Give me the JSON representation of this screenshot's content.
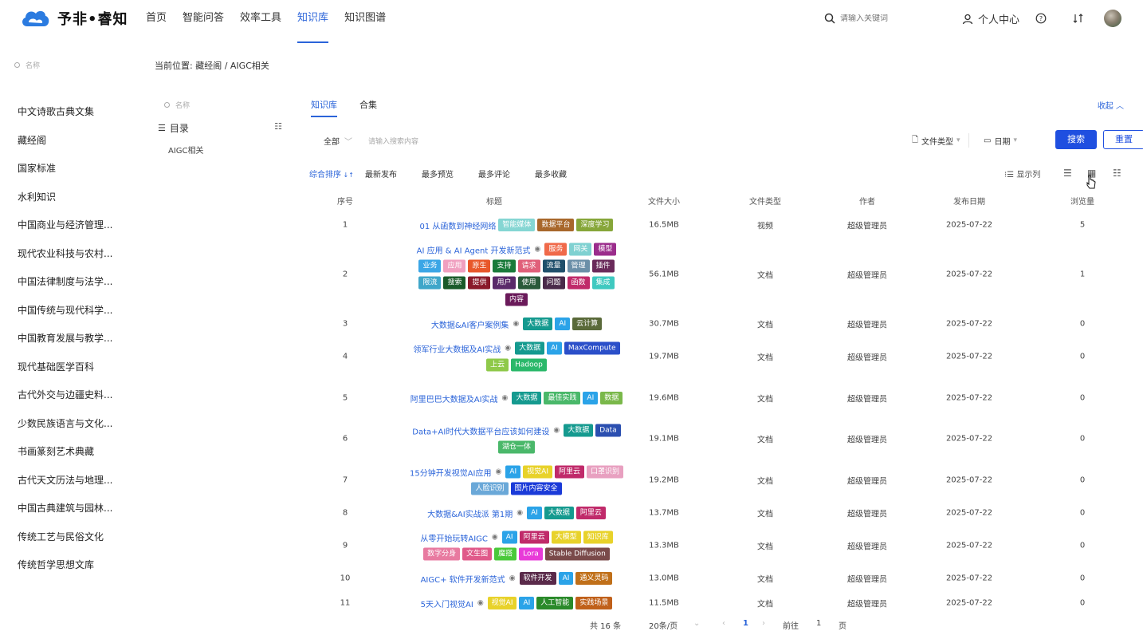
{
  "brand": {
    "name": "予非•睿知"
  },
  "nav": [
    {
      "label": "首页",
      "active": false
    },
    {
      "label": "智能问答",
      "active": false
    },
    {
      "label": "效率工具",
      "active": false
    },
    {
      "label": "知识库",
      "active": true
    },
    {
      "label": "知识图谱",
      "active": false
    }
  ],
  "top_search": {
    "placeholder": "请输入关键词"
  },
  "user_center": {
    "label": "个人中心"
  },
  "sidebar": {
    "search_placeholder": "名称",
    "items": [
      "中文诗歌古典文集",
      "藏经阁",
      "国家标准",
      "水利知识",
      "中国商业与经济管理...",
      "现代农业科技与农村...",
      "中国法律制度与法学...",
      "中国传统与现代科学...",
      "中国教育发展与教学...",
      "现代基础医学百科",
      "古代外交与边疆史料...",
      "少数民族语言与文化...",
      "书画篆刻艺术典藏",
      "古代天文历法与地理...",
      "中国古典建筑与园林...",
      "传统工艺与民俗文化",
      "传统哲学思想文库"
    ]
  },
  "breadcrumb": {
    "text": "当前位置: 藏经阁 / AIGC相关"
  },
  "directory": {
    "search_placeholder": "名称",
    "title": "目录",
    "node": "AIGC相关"
  },
  "tabs": [
    {
      "label": "知识库",
      "active": true
    },
    {
      "label": "合集",
      "active": false
    }
  ],
  "collapse_label": "收起",
  "filters": {
    "scope": "全部",
    "input_placeholder": "请输入搜索内容",
    "file_type": "文件类型",
    "date": "日期",
    "search_button": "搜索",
    "reset_button": "重置"
  },
  "sort": {
    "options": [
      "综合排序",
      "最新发布",
      "最多预览",
      "最多评论",
      "最多收藏"
    ],
    "active_index": 0,
    "display_columns": "显示列"
  },
  "table": {
    "headers": [
      "序号",
      "标题",
      "文件大小",
      "文件类型",
      "作者",
      "发布日期",
      "浏览量"
    ],
    "rows": [
      {
        "no": "1",
        "title": "01 从函数到神经网络",
        "eye": false,
        "tags": [
          {
            "t": "智能媒体",
            "c": "#85d6d3"
          },
          {
            "t": "数据平台",
            "c": "#a8672b"
          },
          {
            "t": "深度学习",
            "c": "#86a639"
          }
        ],
        "size": "16.5MB",
        "type": "视频",
        "author": "超级管理员",
        "date": "2025-07-22",
        "views": "5"
      },
      {
        "no": "2",
        "title": "AI 应用 & AI Agent 开发新范式",
        "eye": true,
        "tags": [
          {
            "t": "服务",
            "c": "#f06a4a"
          },
          {
            "t": "网关",
            "c": "#7fd1d1"
          },
          {
            "t": "模型",
            "c": "#9b2d8c"
          },
          {
            "t": "业务",
            "c": "#3ba6e6"
          },
          {
            "t": "应用",
            "c": "#f0a0c0"
          },
          {
            "t": "原生",
            "c": "#e8572a"
          },
          {
            "t": "支持",
            "c": "#197a3a"
          },
          {
            "t": "请求",
            "c": "#e0607a"
          },
          {
            "t": "流量",
            "c": "#1f4f6b"
          },
          {
            "t": "管理",
            "c": "#6b8fa8"
          },
          {
            "t": "插件",
            "c": "#6a2a5a"
          },
          {
            "t": "限流",
            "c": "#3fa6c9"
          },
          {
            "t": "搜索",
            "c": "#1a5a2a"
          },
          {
            "t": "提供",
            "c": "#8a1a2a"
          },
          {
            "t": "用户",
            "c": "#5a2a6a"
          },
          {
            "t": "使用",
            "c": "#2a5a3a"
          },
          {
            "t": "问题",
            "c": "#4a2a4a"
          },
          {
            "t": "函数",
            "c": "#c02a6a"
          },
          {
            "t": "集成",
            "c": "#3fc9c0"
          },
          {
            "t": "内容",
            "c": "#6a1a5a"
          }
        ],
        "size": "56.1MB",
        "type": "文档",
        "author": "超级管理员",
        "date": "2025-07-22",
        "views": "1"
      },
      {
        "no": "3",
        "title": "大数据&AI客户案例集",
        "eye": true,
        "tags": [
          {
            "t": "大数据",
            "c": "#159a8f"
          },
          {
            "t": "AI",
            "c": "#2ba3e8"
          },
          {
            "t": "云计算",
            "c": "#5a6a3a"
          }
        ],
        "size": "30.7MB",
        "type": "文档",
        "author": "超级管理员",
        "date": "2025-07-22",
        "views": "0"
      },
      {
        "no": "4",
        "title": "领军行业大数据及AI实战",
        "eye": true,
        "tags": [
          {
            "t": "大数据",
            "c": "#159a8f"
          },
          {
            "t": "AI",
            "c": "#2ba3e8"
          },
          {
            "t": "MaxCompute",
            "c": "#2b4fc9"
          },
          {
            "t": "上云",
            "c": "#8fc94a"
          },
          {
            "t": "Hadoop",
            "c": "#2ab86a"
          }
        ],
        "size": "19.7MB",
        "type": "文档",
        "author": "超级管理员",
        "date": "2025-07-22",
        "views": "0"
      },
      {
        "no": "5",
        "title": "阿里巴巴大数据及AI实战",
        "eye": true,
        "tags": [
          {
            "t": "大数据",
            "c": "#159a8f"
          },
          {
            "t": "最佳实践",
            "c": "#4ab86a"
          },
          {
            "t": "AI",
            "c": "#2ba3e8"
          },
          {
            "t": "数据",
            "c": "#7ab84a"
          }
        ],
        "size": "19.6MB",
        "type": "文档",
        "author": "超级管理员",
        "date": "2025-07-22",
        "views": "0"
      },
      {
        "no": "6",
        "title": "Data+AI时代大数据平台应该如何建设",
        "eye": true,
        "tags": [
          {
            "t": "大数据",
            "c": "#159a8f"
          },
          {
            "t": "Data",
            "c": "#2b4fb0"
          },
          {
            "t": "湖仓一体",
            "c": "#4ab86a"
          }
        ],
        "size": "19.1MB",
        "type": "文档",
        "author": "超级管理员",
        "date": "2025-07-22",
        "views": "0"
      },
      {
        "no": "7",
        "title": "15分钟开发视觉AI应用",
        "eye": true,
        "tags": [
          {
            "t": "AI",
            "c": "#2ba3e8"
          },
          {
            "t": "视觉AI",
            "c": "#e8d22a"
          },
          {
            "t": "阿里云",
            "c": "#c02a6a"
          },
          {
            "t": "口罩识别",
            "c": "#e8a0c0"
          },
          {
            "t": "人脸识别",
            "c": "#6aa8d8"
          },
          {
            "t": "图片内容安全",
            "c": "#1a3ad8"
          }
        ],
        "size": "19.2MB",
        "type": "文档",
        "author": "超级管理员",
        "date": "2025-07-22",
        "views": "0"
      },
      {
        "no": "8",
        "title": "大数据&AI实战派 第1期",
        "eye": true,
        "tags": [
          {
            "t": "AI",
            "c": "#2ba3e8"
          },
          {
            "t": "大数据",
            "c": "#159a8f"
          },
          {
            "t": "阿里云",
            "c": "#c02a6a"
          }
        ],
        "size": "13.7MB",
        "type": "文档",
        "author": "超级管理员",
        "date": "2025-07-22",
        "views": "0"
      },
      {
        "no": "9",
        "title": "从零开始玩转AIGC",
        "eye": true,
        "tags": [
          {
            "t": "AI",
            "c": "#2ba3e8"
          },
          {
            "t": "阿里云",
            "c": "#c02a6a"
          },
          {
            "t": "大模型",
            "c": "#e8d22a"
          },
          {
            "t": "知识库",
            "c": "#e8d22a"
          },
          {
            "t": "数字分身",
            "c": "#e87aa0"
          },
          {
            "t": "文生图",
            "c": "#e05a8a"
          },
          {
            "t": "魔搭",
            "c": "#4ac93a"
          },
          {
            "t": "Lora",
            "c": "#e83ad8"
          },
          {
            "t": "Stable Diffusion",
            "c": "#7a4a4a"
          }
        ],
        "size": "13.3MB",
        "type": "文档",
        "author": "超级管理员",
        "date": "2025-07-22",
        "views": "0"
      },
      {
        "no": "10",
        "title": "AIGC+ 软件开发新范式",
        "eye": true,
        "tags": [
          {
            "t": "软件开发",
            "c": "#5a2a4a"
          },
          {
            "t": "AI",
            "c": "#2ba3e8"
          },
          {
            "t": "通义灵码",
            "c": "#c0701a"
          }
        ],
        "size": "13.0MB",
        "type": "文档",
        "author": "超级管理员",
        "date": "2025-07-22",
        "views": "0"
      },
      {
        "no": "11",
        "title": "5天入门视觉AI",
        "eye": true,
        "tags": [
          {
            "t": "视觉AI",
            "c": "#e8d22a"
          },
          {
            "t": "AI",
            "c": "#2ba3e8"
          },
          {
            "t": "人工智能",
            "c": "#2a8a2a"
          },
          {
            "t": "实践场景",
            "c": "#c0601a"
          }
        ],
        "size": "11.5MB",
        "type": "文档",
        "author": "超级管理员",
        "date": "2025-07-22",
        "views": "0"
      }
    ]
  },
  "pagination": {
    "total": "共 16 条",
    "page_size": "20条/页",
    "current": "1",
    "goto_label": "前往",
    "goto_value": "1",
    "page_suffix": "页"
  }
}
